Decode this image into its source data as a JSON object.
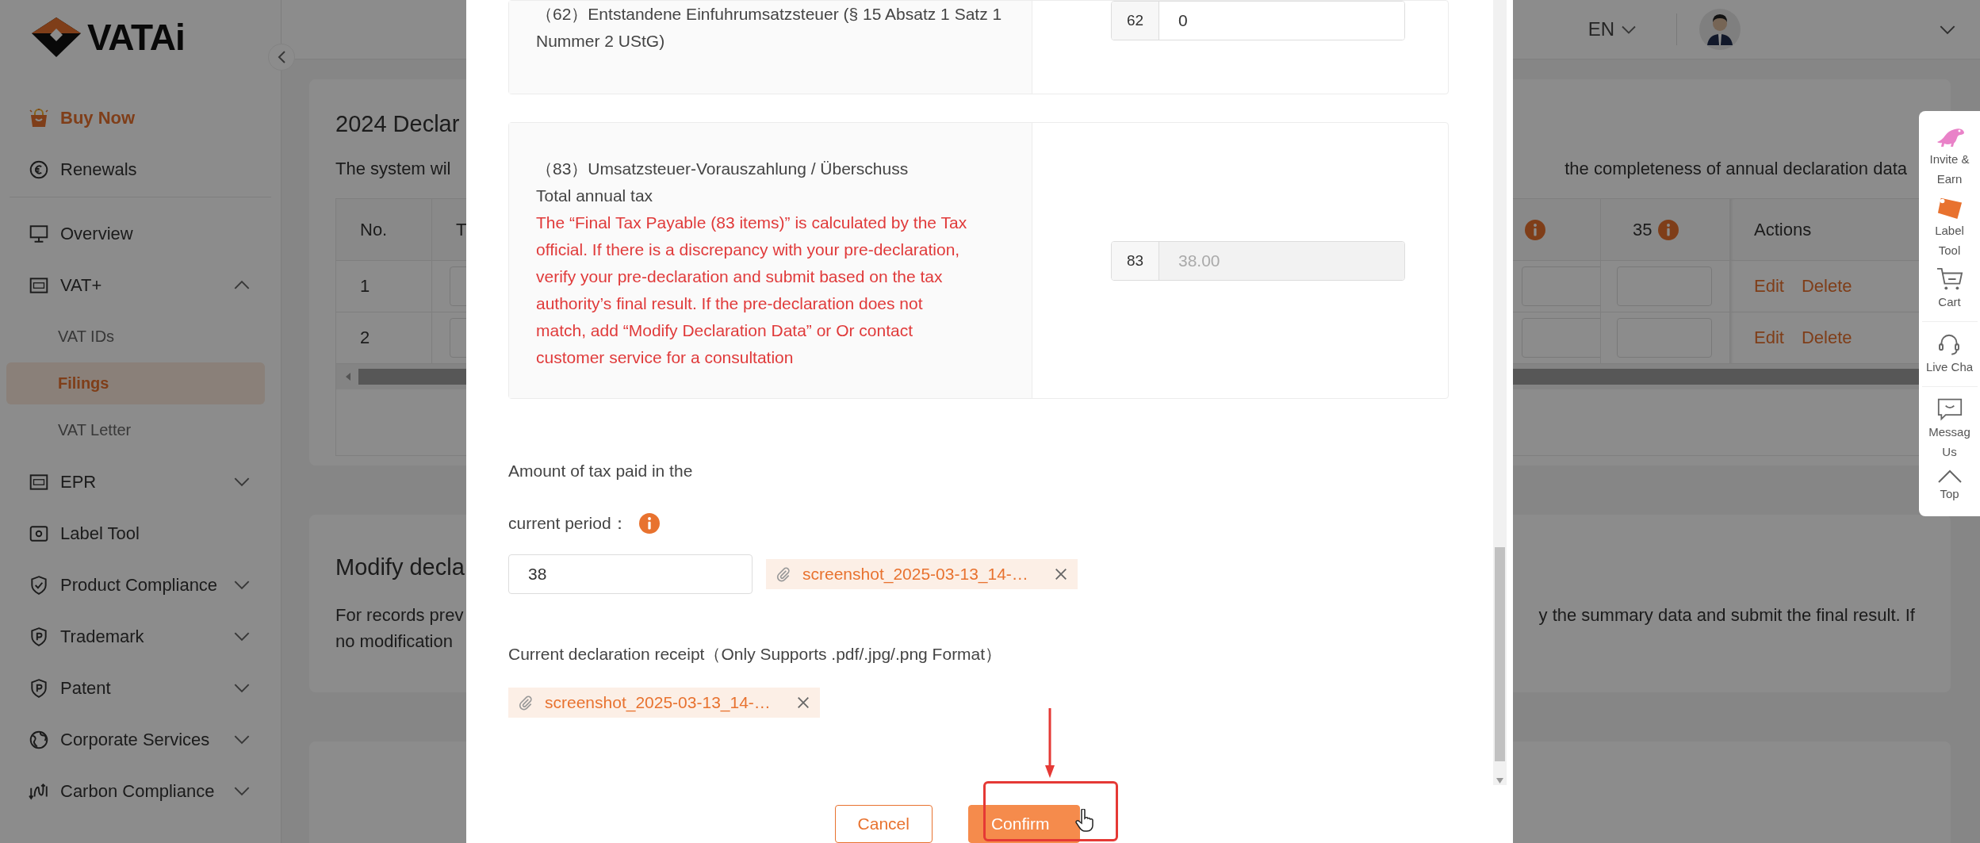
{
  "sidebar": {
    "logo": "VATAi",
    "sections": [
      {
        "items": [
          {
            "label": "Buy Now",
            "kind": "promo",
            "selected": false
          },
          {
            "label": "Renewals",
            "kind": "link",
            "selected": false
          }
        ]
      },
      {
        "items": [
          {
            "label": "Overview",
            "kind": "link",
            "selected": false
          },
          {
            "label": "VAT+",
            "kind": "group",
            "selected": false,
            "expanded": true,
            "children": [
              {
                "label": "VAT IDs",
                "selected": false
              },
              {
                "label": "Filings",
                "selected": true
              },
              {
                "label": "VAT Letter",
                "selected": false
              }
            ]
          },
          {
            "label": "EPR",
            "kind": "group",
            "selected": false,
            "expanded": false
          },
          {
            "label": "Label Tool",
            "kind": "link",
            "selected": false
          },
          {
            "label": "Product Compliance",
            "kind": "group",
            "selected": false,
            "expanded": false
          },
          {
            "label": "Trademark",
            "kind": "group",
            "selected": false,
            "expanded": false
          },
          {
            "label": "Patent",
            "kind": "group",
            "selected": false,
            "expanded": false
          },
          {
            "label": "Corporate Services",
            "kind": "group",
            "selected": false,
            "expanded": false
          },
          {
            "label": "Carbon Compliance",
            "kind": "group",
            "selected": false,
            "expanded": false
          }
        ]
      }
    ]
  },
  "header": {
    "language": "EN"
  },
  "declaration_card": {
    "title": "2024 Declar",
    "description_start": "The system wil",
    "description_end": "the completeness of annual declaration data",
    "table": {
      "columns": [
        {
          "label": "No."
        },
        {
          "label": "T"
        },
        {
          "kind": "info"
        },
        {
          "label": "35",
          "kind": "info"
        },
        {
          "label": "Actions"
        }
      ],
      "rows": [
        {
          "no": "1",
          "actions": [
            "Edit",
            "Delete"
          ]
        },
        {
          "no": "2",
          "actions": [
            "Edit",
            "Delete"
          ]
        }
      ]
    }
  },
  "modify_card": {
    "title": "Modify decla",
    "lines_start": [
      "For records prev",
      "no modification"
    ],
    "line_end": "y the summary data and submit the final result. If"
  },
  "modal": {
    "rows": [
      {
        "label": "（62）Entstandene Einfuhrumsatzsteuer (§ 15 Absatz 1 Satz 1 Nummer 2 UStG)",
        "code": "62",
        "value": "0",
        "disabled": false
      },
      {
        "label": "（83）Umsatzsteuer-Vorauszahlung / Überschuss",
        "sublabel": "Total annual tax",
        "note": "The “Final Tax Payable (83 items)” is calculated by the Tax official. If there is a discrepancy with your pre-declaration, verify your pre-declaration and submit based on the tax authority’s final result. If the pre-declaration does not match, add “Modify Declaration Data” or Or contact customer service for a consultation",
        "code": "83",
        "value": "38.00",
        "disabled": true
      }
    ],
    "amount_label": [
      "Amount of tax paid in the",
      "current period："
    ],
    "amount_value": "38",
    "amount_file": "screenshot_2025-03-13_14-…",
    "receipt_label": "Current declaration receipt（Only Supports .pdf/.jpg/.png Format）",
    "receipt_file": "screenshot_2025-03-13_14-…",
    "buttons": [
      {
        "label": "Cancel",
        "kind": "secondary"
      },
      {
        "label": "Confirm",
        "kind": "primary"
      }
    ]
  },
  "float_panel": {
    "items": [
      {
        "lines": [
          "Invite &",
          "Earn"
        ]
      },
      {
        "lines": [
          "Label",
          "Tool"
        ]
      },
      {
        "lines": [
          "Cart"
        ]
      },
      {
        "lines": [
          "Live Cha"
        ]
      },
      {
        "lines": [
          "Messag",
          "Us"
        ]
      },
      {
        "lines": [
          "Top"
        ]
      }
    ]
  }
}
